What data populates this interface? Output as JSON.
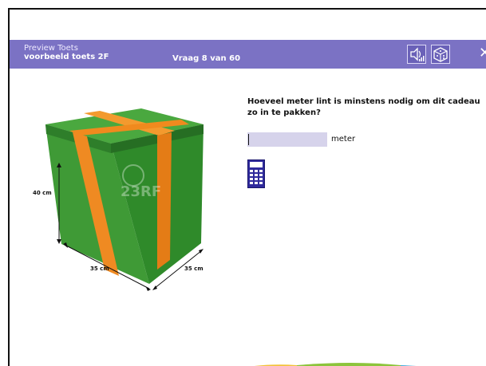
{
  "header": {
    "app_label": "Preview Toets",
    "test_name": "voorbeeld toets 2F",
    "question_counter": "Vraag 8 van 60",
    "speaker_icon": "speaker-icon",
    "dice_icon": "dice-icon",
    "close_icon": "close-icon"
  },
  "figure": {
    "height_label": "40 cm",
    "width_label": "35 cm",
    "depth_label": "35 cm",
    "watermark": "23RF",
    "box_color": "#3e9a3a",
    "ribbon_color": "#f08a1e"
  },
  "question": {
    "text": "Hoeveel meter lint is minstens nodig om dit cadeau zo in te pakken?",
    "answer_value": "",
    "unit_label": "meter",
    "calculator_icon": "calculator-icon"
  },
  "colors": {
    "header_bg": "#7b72c4",
    "input_bg": "#d6d3eb",
    "icon_blue": "#2f2a9c"
  }
}
